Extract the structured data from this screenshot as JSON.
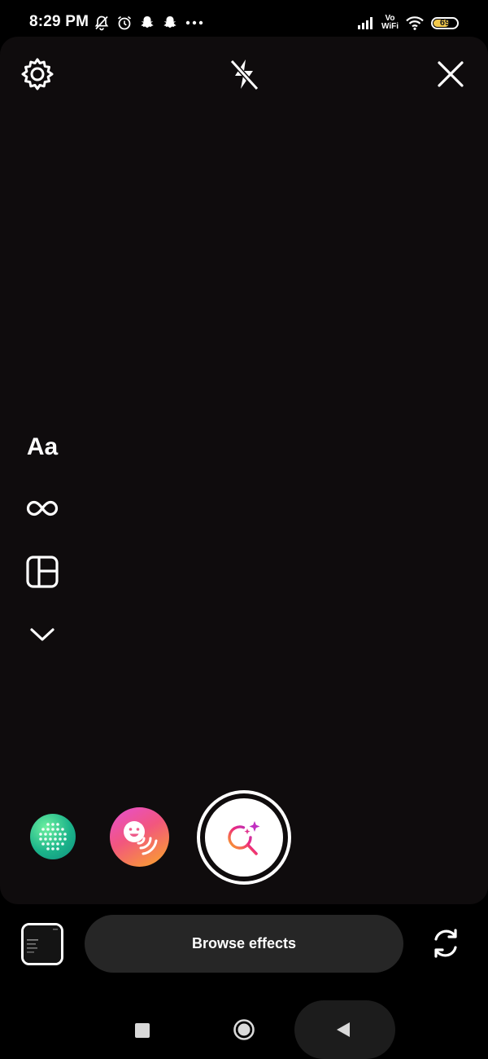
{
  "status_bar": {
    "time": "8:29 PM",
    "left_icons": [
      "notifications-off-icon",
      "alarm-icon",
      "snapchat-icon",
      "snapchat-icon",
      "more-dots-icon"
    ],
    "network_label_top": "Vo",
    "network_label_bottom": "WiFi",
    "battery_level": "69",
    "battery_color": "#f2c94c"
  },
  "top_controls": {
    "settings_icon": "gear-icon",
    "flash_icon": "flash-off-icon",
    "close_icon": "close-icon"
  },
  "side_tools": {
    "create_label": "Aa",
    "boomerang_icon": "infinity-icon",
    "layout_icon": "layout-icon",
    "expand_icon": "chevron-down-icon"
  },
  "effects": {
    "items": [
      "green-dot-effect",
      "smiley-wave-effect"
    ],
    "shutter_icon": "sparkle-search-icon"
  },
  "bottom": {
    "browse_label": "Browse effects",
    "flip_icon": "camera-flip-icon"
  },
  "colors": {
    "background": "#000000",
    "camera_view": "#0f0c0d",
    "browse_button": "#262626",
    "gradient_start": "#f9a826",
    "gradient_end": "#d62976"
  }
}
